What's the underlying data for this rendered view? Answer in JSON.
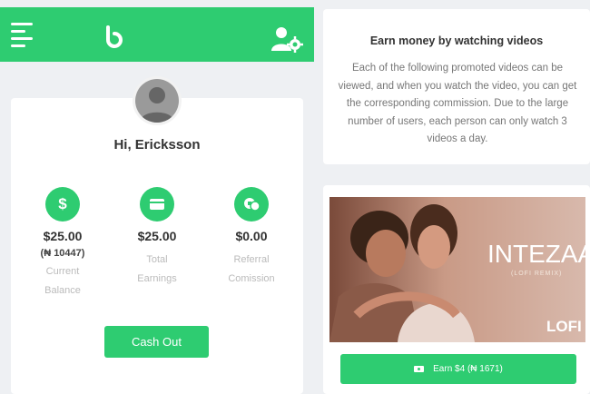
{
  "header": {
    "menu_icon": "hamburger-menu-icon",
    "logo_icon": "brand-logo-icon",
    "account_icon": "user-settings-icon",
    "accent_color": "#2ecc71"
  },
  "profile": {
    "avatar_icon": "user-avatar-icon",
    "greeting": "Hi, Ericksson"
  },
  "stats": [
    {
      "icon": "dollar-icon",
      "icon_glyph": "$",
      "value": "$25.00",
      "sub": "(₦ 10447)",
      "label_line1": "Current",
      "label_line2": "Balance"
    },
    {
      "icon": "wallet-icon",
      "icon_glyph": "",
      "value": "$25.00",
      "sub": "",
      "label_line1": "Total",
      "label_line2": "Earnings"
    },
    {
      "icon": "referral-icon",
      "icon_glyph": "",
      "value": "$0.00",
      "sub": "",
      "label_line1": "Referral",
      "label_line2": "Comission"
    }
  ],
  "cashout_label": "Cash Out",
  "info": {
    "title": "Earn money by watching videos",
    "text": "Each of the following promoted videos can be viewed, and when you watch the video, you can get the corresponding commission. Due to the large number of users, each person can only watch 3 videos a day."
  },
  "video": {
    "thumb_title": "INTEZAAR",
    "thumb_subtitle": "(LOFI REMIX)",
    "thumb_badge": "LOFI",
    "earn_label": "Earn $4 (₦ 1671)",
    "earn_icon": "video-camera-icon"
  }
}
